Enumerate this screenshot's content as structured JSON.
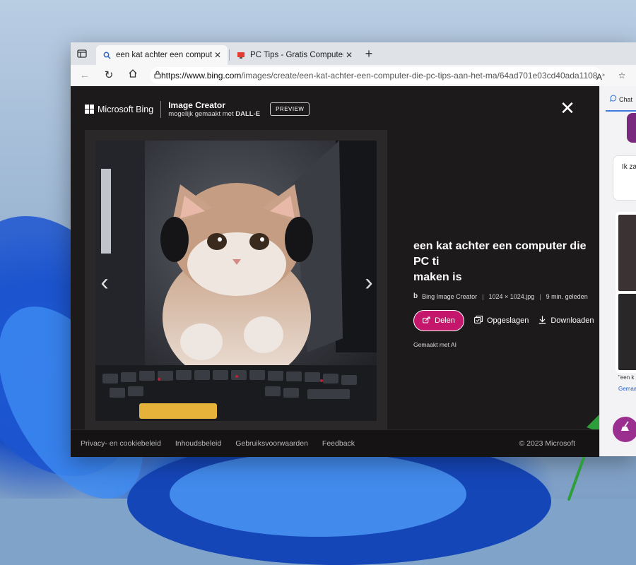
{
  "browser": {
    "tabs": [
      {
        "title": "een kat achter een computer die",
        "active": true
      },
      {
        "title": "PC Tips - Gratis Computer Tips, H",
        "active": false
      }
    ],
    "url_host": "https://www.bing.com",
    "url_path": "/images/create/een-kat-achter-een-computer-die-pc-tips-aan-het-ma/64ad701e03cd40ada1108...",
    "icons": [
      "tab-actions-icon",
      "search-favicon",
      "pc-tips-favicon",
      "close-icon",
      "plus-icon",
      "back-icon",
      "refresh-icon",
      "home-icon",
      "lock-icon",
      "read-aloud-icon",
      "favorite-star-icon"
    ]
  },
  "header": {
    "brand": "Microsoft Bing",
    "product": "Image Creator",
    "subtitle_prefix": "mogelijk gemaakt met ",
    "subtitle_model": "DALL-E",
    "preview_badge": "PREVIEW"
  },
  "viewer": {
    "prev_glyph": "‹",
    "next_glyph": "›",
    "close_glyph": "✕"
  },
  "detail": {
    "headline": "een kat achter een computer die PC ti\nmaken is",
    "source": "Bing Image Creator",
    "dimensions": "1024 × 1024.jpg",
    "age": "9 min. geleden",
    "share_label": "Delen",
    "saved_label": "Opgeslagen",
    "download_label": "Downloaden",
    "ai_note": "Gemaakt met AI"
  },
  "footer": {
    "links": [
      "Privacy- en cookiebeleid",
      "Inhoudsbeleid",
      "Gebruiksvoorwaarden",
      "Feedback"
    ],
    "copyright": "© 2023 Microsoft"
  },
  "sidebar": {
    "tab_label": "Chat",
    "card_text": "Ik za",
    "caption1": "\"een k",
    "caption2": "Gemaa"
  },
  "colors": {
    "share_button": "#c4166a",
    "annotation_arrow": "#2e9e3a",
    "copilot_button": "#9b2f8f"
  }
}
